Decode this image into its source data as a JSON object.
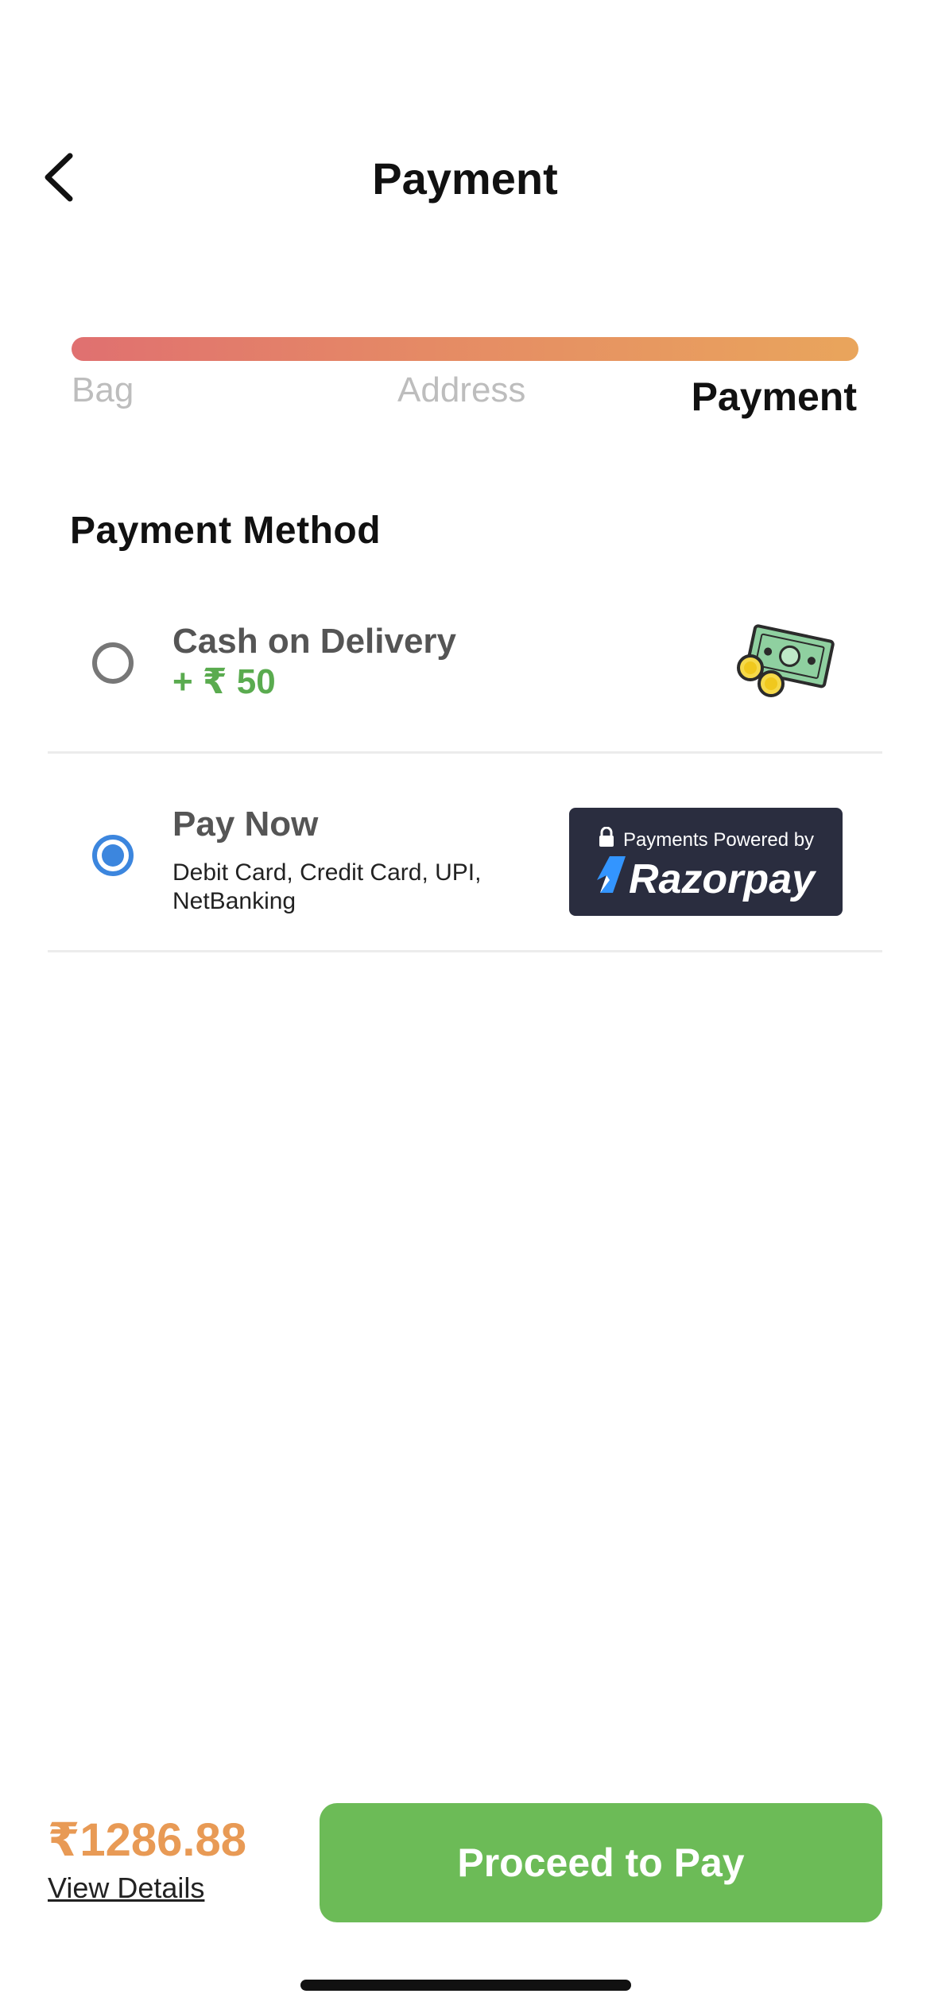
{
  "header": {
    "title": "Payment",
    "back_icon": "chevron-left-icon"
  },
  "progress": {
    "value": 1.0,
    "steps": [
      "Bag",
      "Address",
      "Payment"
    ],
    "active_step": "Payment",
    "colors": {
      "start": "#e07070",
      "end": "#e9a55c"
    }
  },
  "payment_method": {
    "title": "Payment Method",
    "options": [
      {
        "label": "Cash on Delivery",
        "fee": "+ ₹ 50",
        "selected": false,
        "icon": "cash-money-icon"
      },
      {
        "label": "Pay Now",
        "description": "Debit Card, Credit Card, UPI, NetBanking",
        "selected": true,
        "badge": {
          "caption": "Payments Powered by",
          "brand": "Razorpay",
          "icon": "lock-icon"
        }
      }
    ]
  },
  "footer": {
    "total": "₹1286.88",
    "view_details": "View Details",
    "proceed_label": "Proceed to Pay",
    "colors": {
      "total": "#e89a55",
      "button": "#6cbb57",
      "radio_selected": "#3c86de"
    }
  }
}
